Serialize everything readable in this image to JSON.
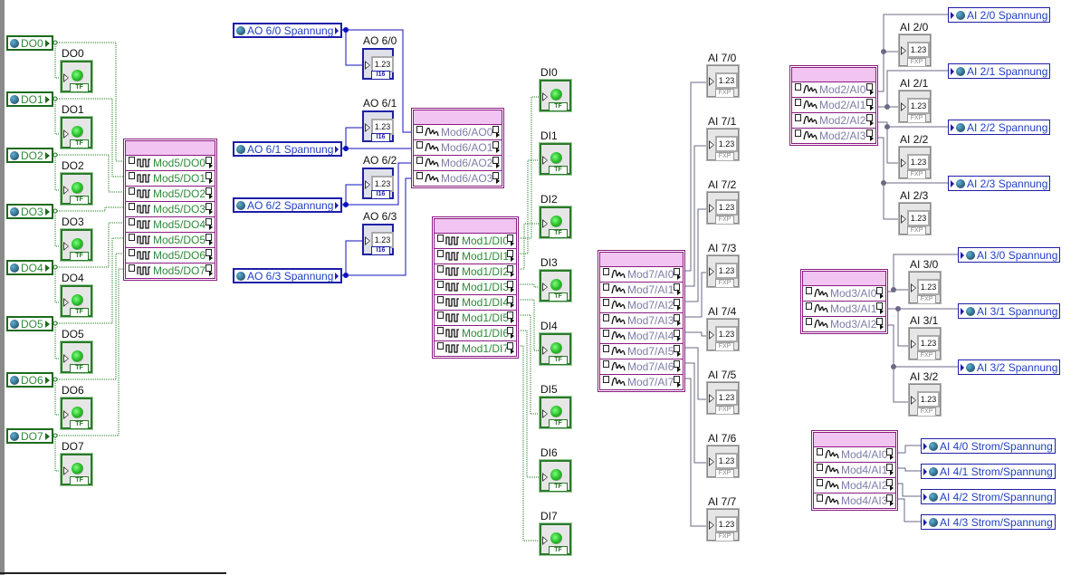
{
  "indicator_text": {
    "numeric_value": "1.23",
    "bool_badge": "TF",
    "i16_badge": "I16",
    "fxp_badge": "FXP"
  },
  "digital_outputs": {
    "globals": [
      "DO0",
      "DO1",
      "DO2",
      "DO3",
      "DO4",
      "DO5",
      "DO6",
      "DO7"
    ],
    "indicators": [
      "DO0",
      "DO1",
      "DO2",
      "DO3",
      "DO4",
      "DO5",
      "DO6",
      "DO7"
    ]
  },
  "mod5": {
    "rows": [
      "Mod5/DO0",
      "Mod5/DO1",
      "Mod5/DO2",
      "Mod5/DO3",
      "Mod5/DO4",
      "Mod5/DO5",
      "Mod5/DO6",
      "Mod5/DO7"
    ]
  },
  "analog_outputs": {
    "globals": [
      "AO 6/0 Spannung",
      "AO 6/1 Spannung",
      "AO 6/2 Spannung",
      "AO 6/3 Spannung"
    ],
    "indicators": [
      "AO 6/0",
      "AO 6/1",
      "AO 6/2",
      "AO 6/3"
    ]
  },
  "mod6": {
    "rows": [
      "Mod6/AO0",
      "Mod6/AO1",
      "Mod6/AO2",
      "Mod6/AO3"
    ]
  },
  "mod1": {
    "rows": [
      "Mod1/DI0",
      "Mod1/DI1",
      "Mod1/DI2",
      "Mod1/DI3",
      "Mod1/DI4",
      "Mod1/DI5",
      "Mod1/DI6",
      "Mod1/DI7"
    ]
  },
  "digital_inputs": {
    "indicators": [
      "DI0",
      "DI1",
      "DI2",
      "DI3",
      "DI4",
      "DI5",
      "DI6",
      "DI7"
    ]
  },
  "mod7": {
    "rows": [
      "Mod7/AI0",
      "Mod7/AI1",
      "Mod7/AI2",
      "Mod7/AI3",
      "Mod7/AI4",
      "Mod7/AI5",
      "Mod7/AI6",
      "Mod7/AI7"
    ]
  },
  "ai7": {
    "indicators": [
      "AI 7/0",
      "AI 7/1",
      "AI 7/2",
      "AI 7/3",
      "AI 7/4",
      "AI 7/5",
      "AI 7/6",
      "AI 7/7"
    ]
  },
  "mod2": {
    "rows": [
      "Mod2/AI0",
      "Mod2/AI1",
      "Mod2/AI2",
      "Mod2/AI3"
    ]
  },
  "ai2": {
    "globals": [
      "AI 2/0 Spannung",
      "AI 2/1 Spannung",
      "AI 2/2 Spannung",
      "AI 2/3 Spannung"
    ],
    "indicators": [
      "AI 2/0",
      "AI 2/1",
      "AI 2/2",
      "AI 2/3"
    ]
  },
  "mod3": {
    "rows": [
      "Mod3/AI0",
      "Mod3/AI1",
      "Mod3/AI2"
    ]
  },
  "ai3": {
    "globals": [
      "AI 3/0 Spannung",
      "AI 3/1 Spannung",
      "AI 3/2 Spannung"
    ],
    "indicators": [
      "AI 3/0",
      "AI 3/1",
      "AI 3/2"
    ]
  },
  "mod4": {
    "rows": [
      "Mod4/AI0",
      "Mod4/AI1",
      "Mod4/AI2",
      "Mod4/AI3"
    ]
  },
  "ai4": {
    "globals": [
      "AI 4/0 Strom/Spannung",
      "AI 4/1 Strom/Spannung",
      "AI 4/2 Strom/Spannung",
      "AI 4/3 Strom/Spannung"
    ]
  },
  "colors": {
    "digital_wire": "#1e7a1e",
    "analog_out_wire": "#1010c0",
    "analog_in_wire": "#6a6a84",
    "cluster_border": "#8a1a80",
    "cluster_header": "#f2c4f2"
  }
}
